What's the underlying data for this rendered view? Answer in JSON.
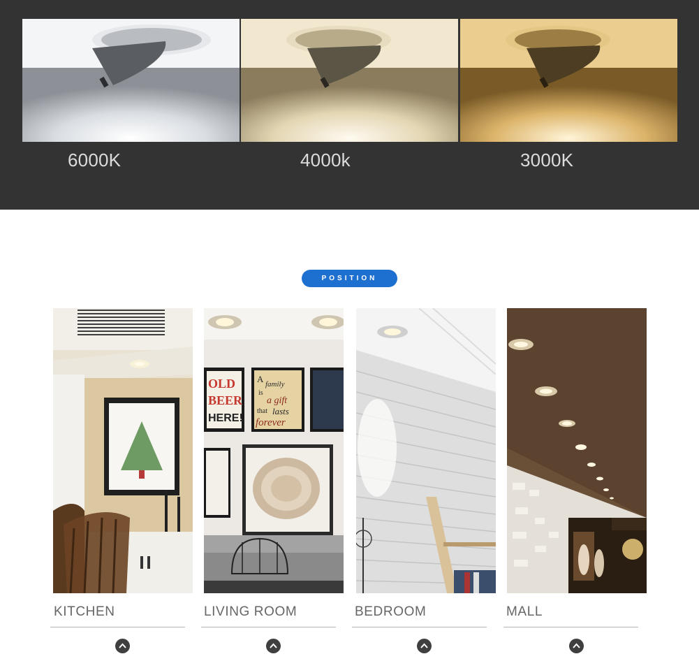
{
  "color_temps": [
    {
      "label": "6000K",
      "tone": "#f2f4f7"
    },
    {
      "label": "4000k",
      "tone": "#efe4c6"
    },
    {
      "label": "3000K",
      "tone": "#e6c27e"
    }
  ],
  "position_badge": "POSITION",
  "rooms": [
    {
      "label": "KITCHEN"
    },
    {
      "label": "LIVING ROOM"
    },
    {
      "label": "BEDROOM"
    },
    {
      "label": "MALL"
    }
  ],
  "poster_text": [
    "OLD",
    "BEER",
    "HERE!"
  ],
  "sign_text": [
    "A",
    "family",
    "is",
    "a gift",
    "that",
    "lasts",
    "forever"
  ],
  "colors": {
    "band": "#333333",
    "badge": "#1d6fd0",
    "label": "#666666"
  }
}
